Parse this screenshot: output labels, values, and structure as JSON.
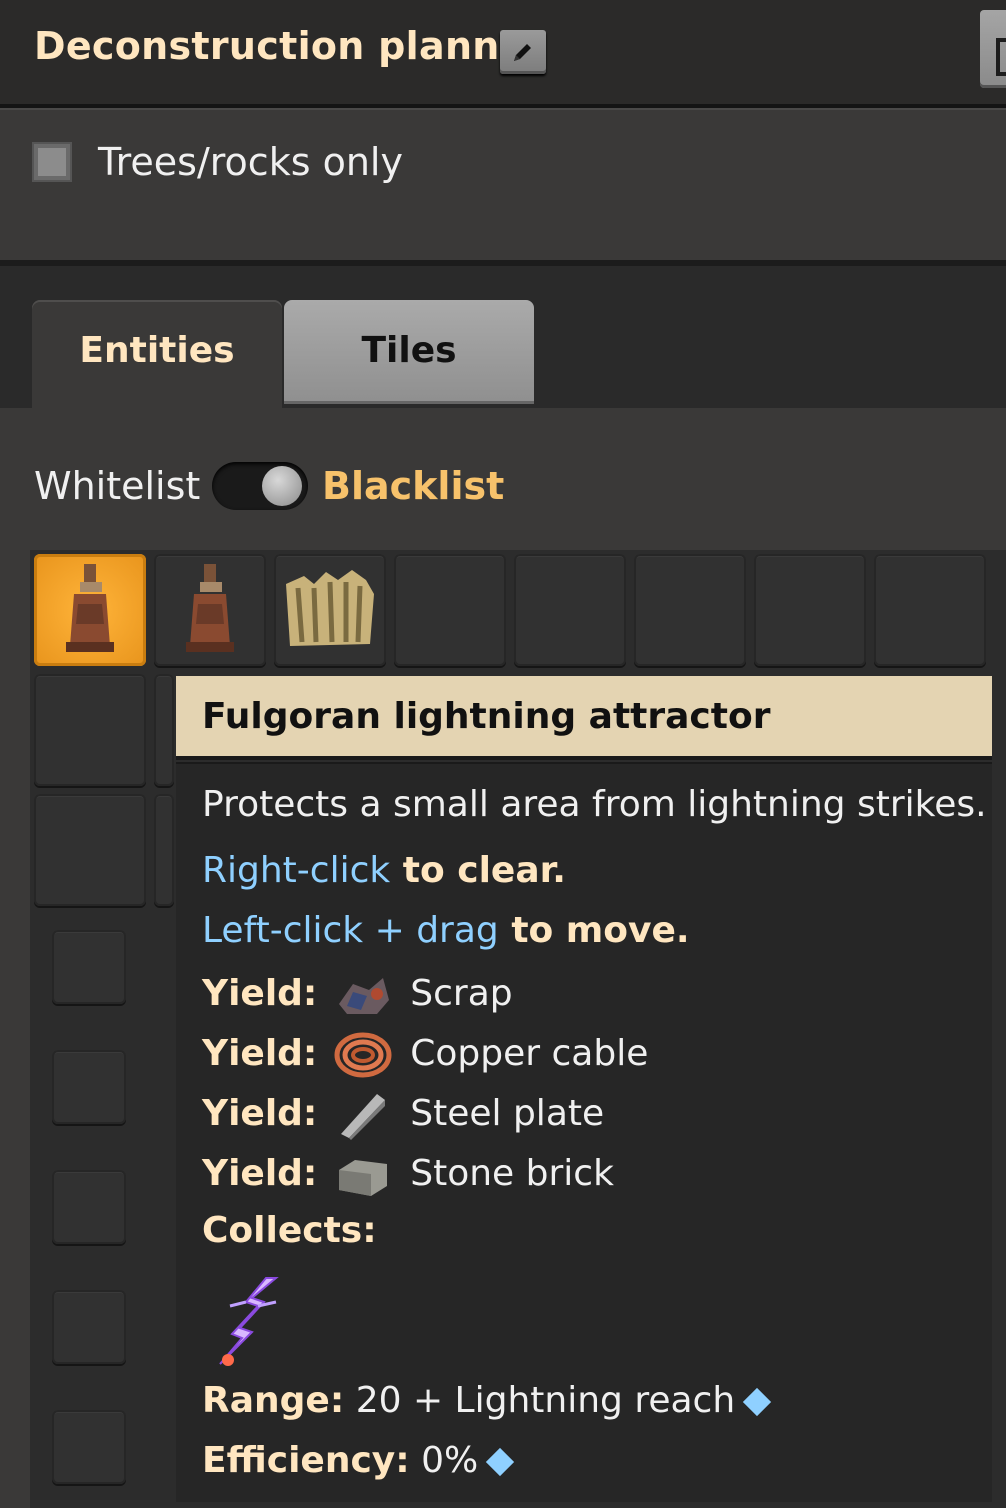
{
  "window": {
    "title": "Deconstruction planner"
  },
  "options": {
    "checkbox_label": "Trees/rocks only",
    "checked": false
  },
  "tabs": [
    {
      "label": "Entities",
      "active": true
    },
    {
      "label": "Tiles",
      "active": false
    }
  ],
  "filter_mode": {
    "left_label": "Whitelist",
    "right_label": "Blacklist",
    "selected": "Blacklist"
  },
  "tooltip": {
    "title": "Fulgoran lightning attractor",
    "description": "Protects a small area from lightning strikes.",
    "right_click": {
      "action": "Right-click",
      "rest": " to clear."
    },
    "left_click": {
      "action": "Left-click + drag",
      "rest": " to move."
    },
    "yield_label": "Yield:",
    "yields": [
      "Scrap",
      "Copper cable",
      "Steel plate",
      "Stone brick"
    ],
    "collects_label": "Collects:",
    "range_label": "Range:",
    "range_value": "20 + Lightning reach",
    "efficiency_label": "Efficiency:",
    "efficiency_value": "0%"
  },
  "colors": {
    "accent_gold": "#ffe6c0",
    "blacklist_orange": "#f7c26b",
    "control_blue": "#8fd0ff",
    "selected_slot": "#f0a02a"
  }
}
